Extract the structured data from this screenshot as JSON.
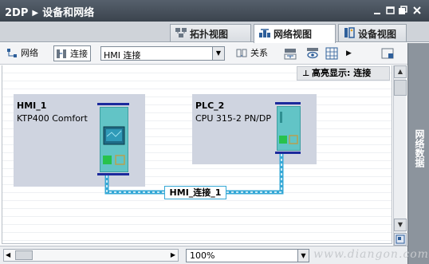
{
  "window": {
    "project": "2DP",
    "title": "设备和网络",
    "controls": [
      "minimize",
      "restore",
      "float",
      "close"
    ]
  },
  "tabs": [
    {
      "label": "拓扑视图",
      "icon": "topology-icon",
      "active": false
    },
    {
      "label": "网络视图",
      "icon": "network-view-icon",
      "active": true
    },
    {
      "label": "设备视图",
      "icon": "device-view-icon",
      "active": false
    }
  ],
  "toolbar": {
    "network_label": "网络",
    "connect_label": "连接",
    "connection_type": "HMI 连接",
    "relations_label": "关系"
  },
  "canvas": {
    "highlight_text": "高亮显示: 连接",
    "stations": [
      {
        "name": "HMI_1",
        "type": "KTP400 Comfort"
      },
      {
        "name": "PLC_2",
        "type": "CPU 315-2 PN/DP"
      }
    ],
    "connection_label": "HMI_连接_1"
  },
  "side_panel": {
    "label": "网络数据"
  },
  "statusbar": {
    "zoom": "100%"
  },
  "watermark": "www.diangon.com",
  "colors": {
    "titlebar": "#3b434d",
    "station_bg": "#cfd4e0",
    "device": "#62c4c6",
    "rail": "#1c2a9c",
    "connection": "#35a8d6",
    "side_panel": "#8c949d"
  }
}
